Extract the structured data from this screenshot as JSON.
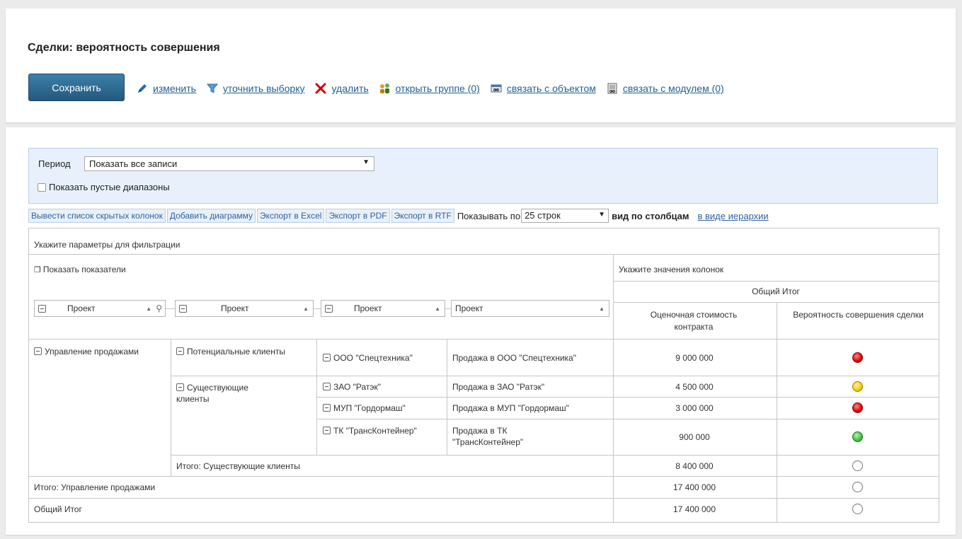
{
  "title": "Сделки: вероятность совершения",
  "buttons": {
    "save": "Сохранить"
  },
  "actions": [
    {
      "label": "изменить",
      "icon": "pencil-icon"
    },
    {
      "label": "уточнить выборку",
      "icon": "filter-icon"
    },
    {
      "label": "удалить",
      "icon": "delete-icon"
    },
    {
      "label": "открыть группе (0)",
      "icon": "group-icon"
    },
    {
      "label": "связать с объектом",
      "icon": "link-object-icon"
    },
    {
      "label": "связать с модулем (0)",
      "icon": "link-module-icon"
    }
  ],
  "filter": {
    "period_label": "Период",
    "period_value": "Показать все записи",
    "empty_ranges_label": "Показать пустые диапазоны",
    "empty_ranges_checked": false
  },
  "toolbar": {
    "hidden_columns": "Вывести список скрытых колонок",
    "add_chart": "Добавить диаграмму",
    "export_excel": "Экспорт в Excel",
    "export_pdf": "Экспорт в PDF",
    "export_rtf": "Экспорт в RTF",
    "show_by": "Показывать по",
    "rows_value": "25 строк",
    "view_columns": "вид по столбцам",
    "view_hierarchy": "в виде иерархии"
  },
  "grid": {
    "filter_hint": "Укажите параметры для фильтрации",
    "show_indicators": "Показать показатели",
    "column_values_hint": "Укажите значения колонок",
    "total_header": "Общий Итог",
    "row_headers": [
      "Проект",
      "Проект",
      "Проект",
      "Проект"
    ],
    "value_headers": [
      "Оценочная стоимость контракта",
      "Вероятность совершения сделки"
    ],
    "level1": "Управление продажами",
    "level2": [
      "Потенциальные клиенты",
      "Существующие клиенты"
    ],
    "rows": [
      {
        "company": "ООО \"Спецтехника\"",
        "deal": "Продажа в ООО \"Спецтехника\"",
        "value": "9 000 000",
        "status": "red"
      },
      {
        "company": "ЗАО \"Ратэк\"",
        "deal": "Продажа в ЗАО \"Ратэк\"",
        "value": "4 500 000",
        "status": "yellow"
      },
      {
        "company": "МУП \"Гордормаш\"",
        "deal": "Продажа в МУП \"Гордормаш\"",
        "value": "3 000 000",
        "status": "red"
      },
      {
        "company": "ТК \"ТрансКонтейнер\"",
        "deal": "Продажа в ТК \"ТрансКонтейнер\"",
        "value": "900 000",
        "status": "green"
      }
    ],
    "subtotal_existing": {
      "label": "Итого: Существующие клиенты",
      "value": "8 400 000"
    },
    "subtotal_sales": {
      "label": "Итого: Управление продажами",
      "value": "17 400 000"
    },
    "grand_total": {
      "label": "Общий Итог",
      "value": "17 400 000"
    }
  },
  "colors": {
    "accent": "#24587c",
    "link": "#1f5f97",
    "filter_bg": "#e8f1fb"
  }
}
